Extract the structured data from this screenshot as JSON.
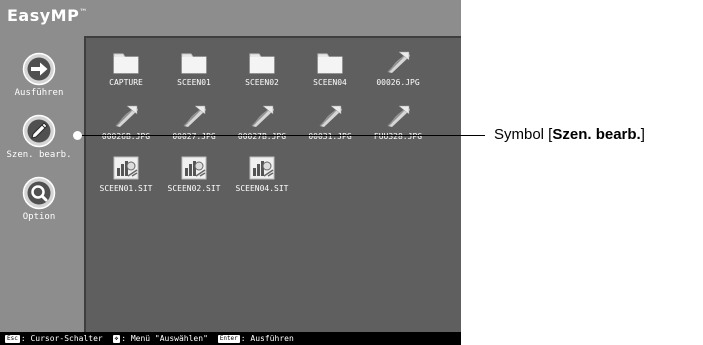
{
  "app": {
    "logo": "EasyMP",
    "logo_tm": "™"
  },
  "sidebar": {
    "items": [
      {
        "label": "Ausführen",
        "icon": "arrow-right-icon"
      },
      {
        "label": "Szen. bearb.",
        "icon": "pencil-icon"
      },
      {
        "label": "Option",
        "icon": "magnifier-icon"
      }
    ]
  },
  "files": [
    {
      "name": "CAPTURE",
      "icon": "folder-icon"
    },
    {
      "name": "SCEEN01",
      "icon": "folder-icon"
    },
    {
      "name": "SCEEN02",
      "icon": "folder-icon"
    },
    {
      "name": "SCEEN04",
      "icon": "folder-icon"
    },
    {
      "name": "00026.JPG",
      "icon": "jpg-image-icon"
    },
    {
      "name": "00026B.JPG",
      "icon": "jpg-image-icon"
    },
    {
      "name": "00027.JPG",
      "icon": "jpg-image-icon"
    },
    {
      "name": "00027B.JPG",
      "icon": "jpg-image-icon"
    },
    {
      "name": "00031.JPG",
      "icon": "jpg-image-icon"
    },
    {
      "name": "FUU328.JPG",
      "icon": "jpg-image-icon"
    },
    {
      "name": "SCEEN01.SIT",
      "icon": "scenario-file-icon"
    },
    {
      "name": "SCEEN02.SIT",
      "icon": "scenario-file-icon"
    },
    {
      "name": "SCEEN04.SIT",
      "icon": "scenario-file-icon"
    }
  ],
  "status_bar": {
    "items": [
      {
        "key": "Esc",
        "text": ": Cursor-Schalter"
      },
      {
        "key": "✥",
        "text": ": Menü \"Auswählen\""
      },
      {
        "key": "Enter",
        "text": ": Ausführen"
      }
    ]
  },
  "callout": {
    "prefix": "Symbol [",
    "bold": "Szen. bearb.",
    "suffix": "]"
  }
}
